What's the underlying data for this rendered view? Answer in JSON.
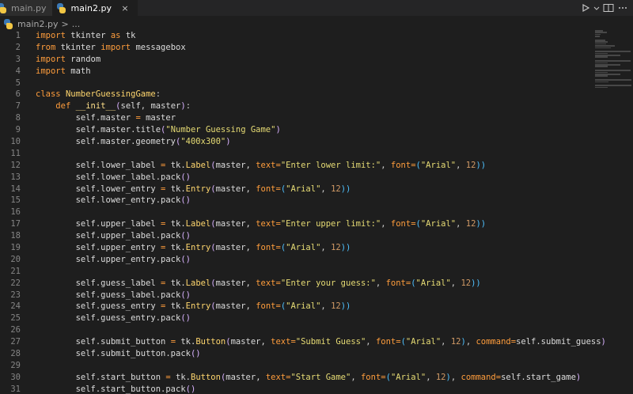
{
  "tabs": [
    {
      "label": "main.py",
      "active": false
    },
    {
      "label": "main2.py",
      "active": true,
      "close": "×"
    }
  ],
  "breadcrumb": {
    "file": "main2.py",
    "sep": ">",
    "more": "..."
  },
  "editor": {
    "lines": [
      {
        "n": "1",
        "tokens": [
          [
            "kw",
            "import "
          ],
          [
            "ident",
            "tkinter "
          ],
          [
            "kw",
            "as "
          ],
          [
            "ident",
            "tk"
          ]
        ]
      },
      {
        "n": "2",
        "tokens": [
          [
            "kw",
            "from "
          ],
          [
            "ident",
            "tkinter "
          ],
          [
            "kw",
            "import "
          ],
          [
            "ident",
            "messagebox"
          ]
        ]
      },
      {
        "n": "3",
        "tokens": [
          [
            "kw",
            "import "
          ],
          [
            "ident",
            "random"
          ]
        ]
      },
      {
        "n": "4",
        "tokens": [
          [
            "kw",
            "import "
          ],
          [
            "ident",
            "math"
          ]
        ]
      },
      {
        "n": "5",
        "tokens": []
      },
      {
        "n": "6",
        "tokens": [
          [
            "kw",
            "class "
          ],
          [
            "cls",
            "NumberGuessingGame"
          ],
          [
            "punc",
            ":"
          ]
        ]
      },
      {
        "n": "7",
        "tokens": [
          [
            "ident",
            "    "
          ],
          [
            "kw",
            "def "
          ],
          [
            "fn",
            "__init__"
          ],
          [
            "paren",
            "("
          ],
          [
            "self",
            "self"
          ],
          [
            "punc",
            ", "
          ],
          [
            "ident",
            "master"
          ],
          [
            "paren",
            ")"
          ],
          [
            "punc",
            ":"
          ]
        ]
      },
      {
        "n": "8",
        "tokens": [
          [
            "ident",
            "        self.master "
          ],
          [
            "kw",
            "= "
          ],
          [
            "ident",
            "master"
          ]
        ]
      },
      {
        "n": "9",
        "tokens": [
          [
            "ident",
            "        self.master.title"
          ],
          [
            "paren",
            "("
          ],
          [
            "str",
            "\"Number Guessing Game\""
          ],
          [
            "paren",
            ")"
          ]
        ]
      },
      {
        "n": "10",
        "tokens": [
          [
            "ident",
            "        self.master.geometry"
          ],
          [
            "paren",
            "("
          ],
          [
            "str",
            "\"400x300\""
          ],
          [
            "paren",
            ")"
          ]
        ]
      },
      {
        "n": "11",
        "tokens": []
      },
      {
        "n": "12",
        "tokens": [
          [
            "ident",
            "        self.lower_label "
          ],
          [
            "kw",
            "= "
          ],
          [
            "ident",
            "tk."
          ],
          [
            "cls",
            "Label"
          ],
          [
            "paren",
            "("
          ],
          [
            "ident",
            "master, "
          ],
          [
            "kw",
            "text"
          ],
          [
            "kw",
            "="
          ],
          [
            "str",
            "\"Enter lower limit:\""
          ],
          [
            "punc",
            ", "
          ],
          [
            "kw",
            "font"
          ],
          [
            "kw",
            "="
          ],
          [
            "paren2",
            "("
          ],
          [
            "str",
            "\"Arial\""
          ],
          [
            "punc",
            ", "
          ],
          [
            "num",
            "12"
          ],
          [
            "paren2",
            "))"
          ]
        ]
      },
      {
        "n": "13",
        "tokens": [
          [
            "ident",
            "        self.lower_label.pack"
          ],
          [
            "paren",
            "()"
          ]
        ]
      },
      {
        "n": "14",
        "tokens": [
          [
            "ident",
            "        self.lower_entry "
          ],
          [
            "kw",
            "= "
          ],
          [
            "ident",
            "tk."
          ],
          [
            "cls",
            "Entry"
          ],
          [
            "paren",
            "("
          ],
          [
            "ident",
            "master, "
          ],
          [
            "kw",
            "font"
          ],
          [
            "kw",
            "="
          ],
          [
            "paren2",
            "("
          ],
          [
            "str",
            "\"Arial\""
          ],
          [
            "punc",
            ", "
          ],
          [
            "num",
            "12"
          ],
          [
            "paren2",
            "))"
          ]
        ]
      },
      {
        "n": "15",
        "tokens": [
          [
            "ident",
            "        self.lower_entry.pack"
          ],
          [
            "paren",
            "()"
          ]
        ]
      },
      {
        "n": "16",
        "tokens": []
      },
      {
        "n": "17",
        "tokens": [
          [
            "ident",
            "        self.upper_label "
          ],
          [
            "kw",
            "= "
          ],
          [
            "ident",
            "tk."
          ],
          [
            "cls",
            "Label"
          ],
          [
            "paren",
            "("
          ],
          [
            "ident",
            "master, "
          ],
          [
            "kw",
            "text"
          ],
          [
            "kw",
            "="
          ],
          [
            "str",
            "\"Enter upper limit:\""
          ],
          [
            "punc",
            ", "
          ],
          [
            "kw",
            "font"
          ],
          [
            "kw",
            "="
          ],
          [
            "paren2",
            "("
          ],
          [
            "str",
            "\"Arial\""
          ],
          [
            "punc",
            ", "
          ],
          [
            "num",
            "12"
          ],
          [
            "paren2",
            "))"
          ]
        ]
      },
      {
        "n": "18",
        "tokens": [
          [
            "ident",
            "        self.upper_label.pack"
          ],
          [
            "paren",
            "()"
          ]
        ]
      },
      {
        "n": "19",
        "tokens": [
          [
            "ident",
            "        self.upper_entry "
          ],
          [
            "kw",
            "= "
          ],
          [
            "ident",
            "tk."
          ],
          [
            "cls",
            "Entry"
          ],
          [
            "paren",
            "("
          ],
          [
            "ident",
            "master, "
          ],
          [
            "kw",
            "font"
          ],
          [
            "kw",
            "="
          ],
          [
            "paren2",
            "("
          ],
          [
            "str",
            "\"Arial\""
          ],
          [
            "punc",
            ", "
          ],
          [
            "num",
            "12"
          ],
          [
            "paren2",
            "))"
          ]
        ]
      },
      {
        "n": "20",
        "tokens": [
          [
            "ident",
            "        self.upper_entry.pack"
          ],
          [
            "paren",
            "()"
          ]
        ]
      },
      {
        "n": "21",
        "tokens": []
      },
      {
        "n": "22",
        "tokens": [
          [
            "ident",
            "        self.guess_label "
          ],
          [
            "kw",
            "= "
          ],
          [
            "ident",
            "tk."
          ],
          [
            "cls",
            "Label"
          ],
          [
            "paren",
            "("
          ],
          [
            "ident",
            "master, "
          ],
          [
            "kw",
            "text"
          ],
          [
            "kw",
            "="
          ],
          [
            "str",
            "\"Enter your guess:\""
          ],
          [
            "punc",
            ", "
          ],
          [
            "kw",
            "font"
          ],
          [
            "kw",
            "="
          ],
          [
            "paren2",
            "("
          ],
          [
            "str",
            "\"Arial\""
          ],
          [
            "punc",
            ", "
          ],
          [
            "num",
            "12"
          ],
          [
            "paren2",
            "))"
          ]
        ]
      },
      {
        "n": "23",
        "tokens": [
          [
            "ident",
            "        self.guess_label.pack"
          ],
          [
            "paren",
            "()"
          ]
        ]
      },
      {
        "n": "24",
        "tokens": [
          [
            "ident",
            "        self.guess_entry "
          ],
          [
            "kw",
            "= "
          ],
          [
            "ident",
            "tk."
          ],
          [
            "cls",
            "Entry"
          ],
          [
            "paren",
            "("
          ],
          [
            "ident",
            "master, "
          ],
          [
            "kw",
            "font"
          ],
          [
            "kw",
            "="
          ],
          [
            "paren2",
            "("
          ],
          [
            "str",
            "\"Arial\""
          ],
          [
            "punc",
            ", "
          ],
          [
            "num",
            "12"
          ],
          [
            "paren2",
            "))"
          ]
        ]
      },
      {
        "n": "25",
        "tokens": [
          [
            "ident",
            "        self.guess_entry.pack"
          ],
          [
            "paren",
            "()"
          ]
        ]
      },
      {
        "n": "26",
        "tokens": []
      },
      {
        "n": "27",
        "tokens": [
          [
            "ident",
            "        self.submit_button "
          ],
          [
            "kw",
            "= "
          ],
          [
            "ident",
            "tk."
          ],
          [
            "cls",
            "Button"
          ],
          [
            "paren",
            "("
          ],
          [
            "ident",
            "master, "
          ],
          [
            "kw",
            "text"
          ],
          [
            "kw",
            "="
          ],
          [
            "str",
            "\"Submit Guess\""
          ],
          [
            "punc",
            ", "
          ],
          [
            "kw",
            "font"
          ],
          [
            "kw",
            "="
          ],
          [
            "paren2",
            "("
          ],
          [
            "str",
            "\"Arial\""
          ],
          [
            "punc",
            ", "
          ],
          [
            "num",
            "12"
          ],
          [
            "paren2",
            ")"
          ],
          [
            "punc",
            ", "
          ],
          [
            "kw",
            "command"
          ],
          [
            "kw",
            "="
          ],
          [
            "ident",
            "self.submit_guess"
          ],
          [
            "paren",
            ")"
          ]
        ]
      },
      {
        "n": "28",
        "tokens": [
          [
            "ident",
            "        self.submit_button.pack"
          ],
          [
            "paren",
            "()"
          ]
        ]
      },
      {
        "n": "29",
        "tokens": []
      },
      {
        "n": "30",
        "tokens": [
          [
            "ident",
            "        self.start_button "
          ],
          [
            "kw",
            "= "
          ],
          [
            "ident",
            "tk."
          ],
          [
            "cls",
            "Button"
          ],
          [
            "paren",
            "("
          ],
          [
            "ident",
            "master, "
          ],
          [
            "kw",
            "text"
          ],
          [
            "kw",
            "="
          ],
          [
            "str",
            "\"Start Game\""
          ],
          [
            "punc",
            ", "
          ],
          [
            "kw",
            "font"
          ],
          [
            "kw",
            "="
          ],
          [
            "paren2",
            "("
          ],
          [
            "str",
            "\"Arial\""
          ],
          [
            "punc",
            ", "
          ],
          [
            "num",
            "12"
          ],
          [
            "paren2",
            ")"
          ],
          [
            "punc",
            ", "
          ],
          [
            "kw",
            "command"
          ],
          [
            "kw",
            "="
          ],
          [
            "ident",
            "self.start_game"
          ],
          [
            "paren",
            ")"
          ]
        ]
      },
      {
        "n": "31",
        "tokens": [
          [
            "ident",
            "        self.start_button.pack"
          ],
          [
            "paren",
            "()"
          ]
        ]
      }
    ]
  },
  "colors": {
    "background": "#1e1e1e",
    "keyword": "#ff9d3c",
    "string": "#e6db74",
    "number": "#d19a66",
    "class": "#ffd66e"
  },
  "icons": {
    "file": "python-icon",
    "run": "play-icon",
    "more": "ellipsis-icon"
  }
}
